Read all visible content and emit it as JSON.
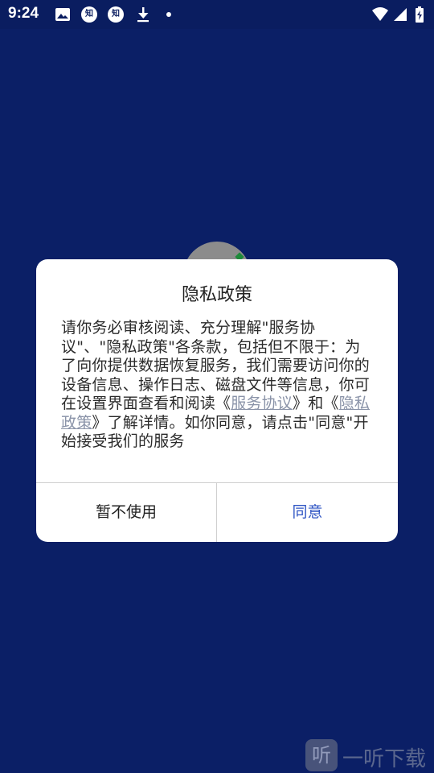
{
  "status_bar": {
    "time": "9:24",
    "icons_left": [
      "image-icon",
      "zhihu-icon",
      "zhihu-icon",
      "download-icon",
      "dot-icon"
    ],
    "icons_right": [
      "wifi-icon",
      "signal-icon",
      "battery-icon"
    ],
    "zhihu_label": "知"
  },
  "dialog": {
    "title": "隐私政策",
    "body_text_1": "请你务必审核阅读、充分理解\"服务协议\"、\"隐私政策\"各条款，包括但不限于：为了向你提供数据恢复服务，我们需要访问你的设备信息、操作日志、磁盘文件等信息，你可在设置界面查看和阅读《",
    "link_service": "服务协议",
    "body_text_2": "》和《",
    "link_privacy": "隐私政策",
    "body_text_3": "》了解详情。如你同意，请点击\"同意\"开始接受我们的服务",
    "decline_label": "暂不使用",
    "agree_label": "同意"
  },
  "watermark": {
    "badge": "听",
    "text": "一听下载"
  },
  "colors": {
    "background": "#0b1f66",
    "agree_button": "#2f55c4",
    "link": "#8a93a8"
  }
}
